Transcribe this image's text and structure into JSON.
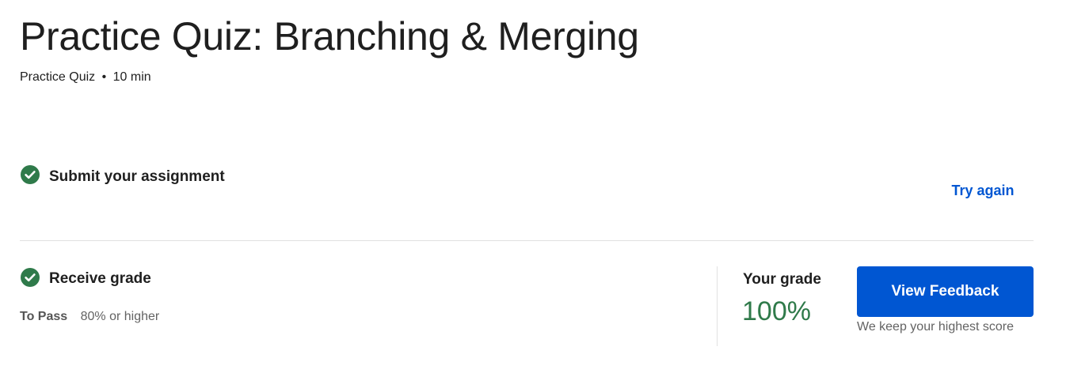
{
  "header": {
    "title": "Practice Quiz: Branching & Merging",
    "meta_type": "Practice Quiz",
    "meta_separator": "•",
    "meta_duration": "10 min"
  },
  "submit_step": {
    "title": "Submit your assignment",
    "status_icon": "check-circle-icon",
    "try_again_label": "Try again"
  },
  "grade_step": {
    "title": "Receive grade",
    "status_icon": "check-circle-icon",
    "to_pass_label": "To Pass",
    "to_pass_value": "80% or higher",
    "your_grade_label": "Your grade",
    "your_grade_value": "100%",
    "view_feedback_label": "View Feedback",
    "highest_score_note": "We keep your highest score"
  },
  "colors": {
    "accent": "#0056d2",
    "success": "#2f7a4a",
    "text": "#1f1f1f",
    "muted": "#636363",
    "divider": "#e1e1e1"
  }
}
